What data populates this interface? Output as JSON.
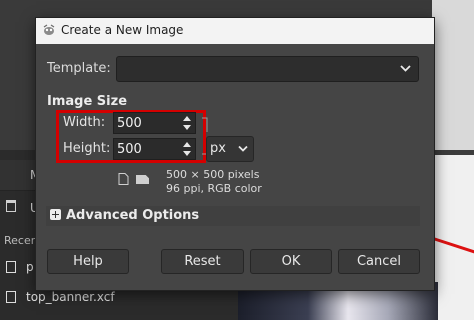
{
  "dialog": {
    "title": "Create a New Image",
    "template_label": "Template:",
    "template_value": "",
    "section_title": "Image Size",
    "width_label": "Width:",
    "width_value": "500",
    "height_label": "Height:",
    "height_value": "500",
    "unit": "px",
    "info_line1": "500 × 500 pixels",
    "info_line2": "96 ppi, RGB color",
    "advanced_label": "Advanced Options",
    "buttons": {
      "help": "Help",
      "reset": "Reset",
      "ok": "OK",
      "cancel": "Cancel"
    }
  },
  "background": {
    "tab_label": "M",
    "u_label": "U",
    "recent_label": "Recen",
    "files": [
      "p",
      "top_banner.xcf"
    ]
  },
  "colors": {
    "dialog_bg": "#454545",
    "highlight": "#d40000",
    "titlebar_bg": "#f3f3f3"
  },
  "icons": {
    "title": "gimp-logo-icon",
    "template_dropdown": "chevron-down-icon",
    "unit_dropdown": "chevron-down-icon",
    "expander": "plus-icon",
    "chain": "chain-link-icon",
    "portrait": "portrait-orientation-icon",
    "landscape": "landscape-orientation-icon"
  }
}
